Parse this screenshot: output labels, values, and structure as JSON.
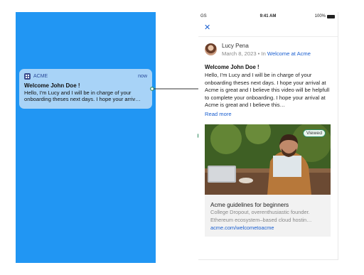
{
  "notification": {
    "app_name": "ACME",
    "time": "now",
    "title": "Welcome John Doe !",
    "body": "Hello, I'm Lucy and I will be in charge of your onboarding theses next days. I hope your arriv…"
  },
  "status_bar": {
    "carrier": "GS",
    "time": "9:41 AM",
    "battery": "100%"
  },
  "post": {
    "author": "Lucy Pena",
    "date": "March 8, 2023",
    "in_prefix": "In",
    "community": "Welcome at Acme",
    "title": "Welcome John Doe !",
    "body": "Hello, I'm Lucy and I will be in charge of your onboarding theses next days. I hope your arrival at Acme is great and I believe this video will be helpfull to complete your onboarding. I hope your arrival at Acme is great and I believe this…",
    "read_more": "Read more"
  },
  "card": {
    "badge": "Viewed",
    "title": "Acme guidelines for beginners",
    "description": "College Dropout, overenthusiastic founder. Ethereum ecosystem–based cloud hostin…",
    "link": "acme.com/welcometoacme"
  },
  "icons": {
    "close": "close-icon",
    "app": "grid-icon"
  },
  "colors": {
    "lockscreen_bg": "#2196f3",
    "notification_bg": "#a8d3f7",
    "accent": "#1a5fd0",
    "connector": "#2f8a5e"
  }
}
